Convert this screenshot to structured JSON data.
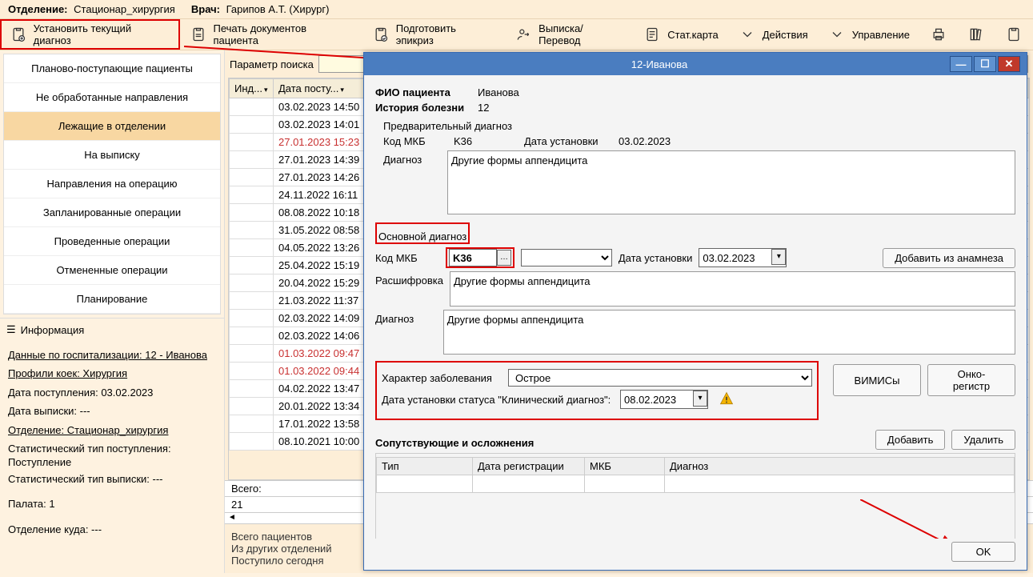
{
  "top": {
    "dept_label": "Отделение:",
    "dept_value": "Стационар_хирургия",
    "doctor_label": "Врач:",
    "doctor_value": "Гарипов А.Т. (Хирург)"
  },
  "toolbar": {
    "set_diag": "Установить текущий диагноз",
    "print_docs": "Печать документов пациента",
    "epicrisis": "Подготовить эпикриз",
    "discharge": "Выписка/Перевод",
    "statcard": "Стат.карта",
    "actions": "Действия",
    "manage": "Управление"
  },
  "nav": {
    "items": [
      "Планово-поступающие пациенты",
      "Не обработанные направления",
      "Лежащиe в отделении",
      "На выписку",
      "Направления на операцию",
      "Запланированные операции",
      "Проведенные операции",
      "Отмененные операции",
      "Планирование"
    ],
    "active": 2
  },
  "info": {
    "hdr": "Информация",
    "lines": {
      "hosp": "Данные по госпитализации: 12 - Иванова ",
      "profiles": "Профили коек: Хирургия",
      "adm_date": "Дата поступления: 03.02.2023",
      "dis_date": "Дата выписки: ---",
      "dept": "Отделение: Стационар_хирургия",
      "stat_in": "Статистический тип поступления: Поступление",
      "stat_out": "Статистический тип выписки: ---",
      "ward": "Палата: 1",
      "dept_to": "Отделение куда: ---"
    }
  },
  "mid": {
    "search_label": "Параметр поиска",
    "cols": {
      "ind": "Инд...",
      "date": "Дата  посту..."
    },
    "rows": [
      {
        "d": "03.02.2023 14:50",
        "r": 0
      },
      {
        "d": "03.02.2023 14:01",
        "r": 0
      },
      {
        "d": "27.01.2023 15:23",
        "r": 1
      },
      {
        "d": "27.01.2023 14:39",
        "r": 0
      },
      {
        "d": "27.01.2023 14:26",
        "r": 0
      },
      {
        "d": "24.11.2022 16:11",
        "r": 0
      },
      {
        "d": "08.08.2022 10:18",
        "r": 0
      },
      {
        "d": "31.05.2022 08:58",
        "r": 0
      },
      {
        "d": "04.05.2022 13:26",
        "r": 0
      },
      {
        "d": "25.04.2022 15:19",
        "r": 0
      },
      {
        "d": "20.04.2022 15:29",
        "r": 0
      },
      {
        "d": "21.03.2022 11:37",
        "r": 0
      },
      {
        "d": "02.03.2022 14:09",
        "r": 0
      },
      {
        "d": "02.03.2022 14:06",
        "r": 0
      },
      {
        "d": "01.03.2022 09:47",
        "r": 1
      },
      {
        "d": "01.03.2022 09:44",
        "r": 1
      },
      {
        "d": "04.02.2022 13:47",
        "r": 0
      },
      {
        "d": "20.01.2022 13:34",
        "r": 0
      },
      {
        "d": "17.01.2022 13:58",
        "r": 0
      },
      {
        "d": "08.10.2021 10:00",
        "r": 0
      }
    ],
    "total_label": "Всего:",
    "total": "21",
    "foot1": "Всего пациентов",
    "foot2": "Из других отделений",
    "foot3": "Поступило сегодня"
  },
  "dlg": {
    "title": "12-Иванова",
    "fio_l": "ФИО пациента",
    "fio_v": "Иванова",
    "hist_l": "История болезни",
    "hist_v": "12",
    "preddiag": "Предварительный диагноз",
    "mkb_l": "Код МКБ",
    "mkb_v": "K36",
    "date_set_l": "Дата установки",
    "date_set_v": "03.02.2023",
    "diag_l": "Диагноз",
    "diag_text": "Другие формы аппендицита",
    "main_diag": "Основной диагноз",
    "main_mkb": "K36",
    "main_date": "03.02.2023",
    "add_anamnez": "Добавить из анамнеза",
    "decode_l": "Расшифровка",
    "decode_text": "Другие формы аппендицита",
    "main_diag_text": "Другие формы аппендицита",
    "nature_l": "Характер заболевания",
    "nature_v": "Острое",
    "clin_date_l": "Дата установки статуса \"Клинический диагноз\":",
    "clin_date_v": "08.02.2023",
    "vimis": "ВИМИСы",
    "onco": "Онко-регистр",
    "comorb_hdr": "Сопутствующие и осложнения",
    "add_btn": "Добавить",
    "del_btn": "Удалить",
    "cols": {
      "type": "Тип",
      "regdate": "Дата регистрации",
      "mkb": "МКБ",
      "diag": "Диагноз"
    },
    "ok": "OK"
  }
}
